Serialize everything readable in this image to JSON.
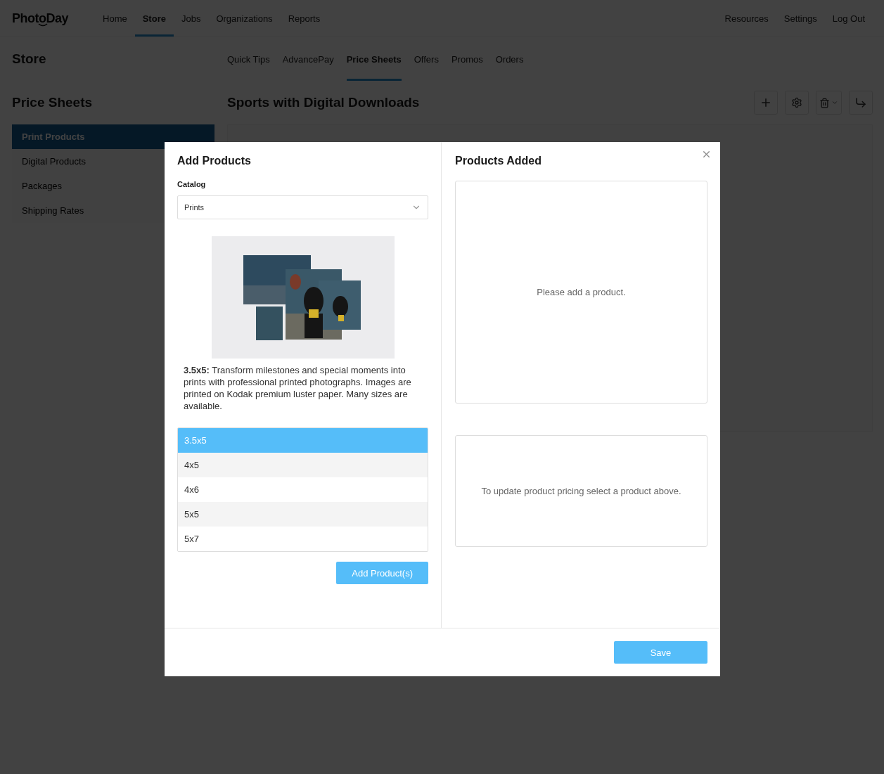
{
  "logo": "PhotoDay",
  "nav": [
    {
      "label": "Home",
      "selected": false
    },
    {
      "label": "Store",
      "selected": true
    },
    {
      "label": "Jobs",
      "selected": false
    },
    {
      "label": "Organizations",
      "selected": false
    },
    {
      "label": "Reports",
      "selected": false
    }
  ],
  "nav_right": [
    "Resources",
    "Settings",
    "Log Out"
  ],
  "page_title": "Store",
  "subnav": [
    {
      "label": "Quick Tips",
      "selected": false
    },
    {
      "label": "AdvancePay",
      "selected": false
    },
    {
      "label": "Price Sheets",
      "selected": true
    },
    {
      "label": "Offers",
      "selected": false
    },
    {
      "label": "Promos",
      "selected": false
    },
    {
      "label": "Orders",
      "selected": false
    }
  ],
  "sidebar": {
    "title": "Price Sheets",
    "items": [
      {
        "label": "Print Products",
        "selected": true
      },
      {
        "label": "Digital Products",
        "selected": false
      },
      {
        "label": "Packages",
        "selected": false
      },
      {
        "label": "Shipping Rates",
        "selected": false
      }
    ]
  },
  "price_sheet_title": "Sports with Digital Downloads",
  "modal": {
    "left_title": "Add Products",
    "catalog_label": "Catalog",
    "catalog_value": "Prints",
    "description": "**3.5x5:** Transform milestones and special moments into prints with professional printed photographs. Images are printed on Kodak premium luster paper. Many sizes are available.",
    "products": [
      {
        "label": "3.5x5",
        "selected": true
      },
      {
        "label": "4x5",
        "selected": false
      },
      {
        "label": "4x6",
        "selected": false
      },
      {
        "label": "5x5",
        "selected": false
      },
      {
        "label": "5x7",
        "selected": false
      }
    ],
    "add_button": "Add Product(s)",
    "right_title": "Products Added",
    "empty_added": "Please add a product.",
    "pricing_hint": "To update product pricing select a product above.",
    "save_button": "Save"
  }
}
